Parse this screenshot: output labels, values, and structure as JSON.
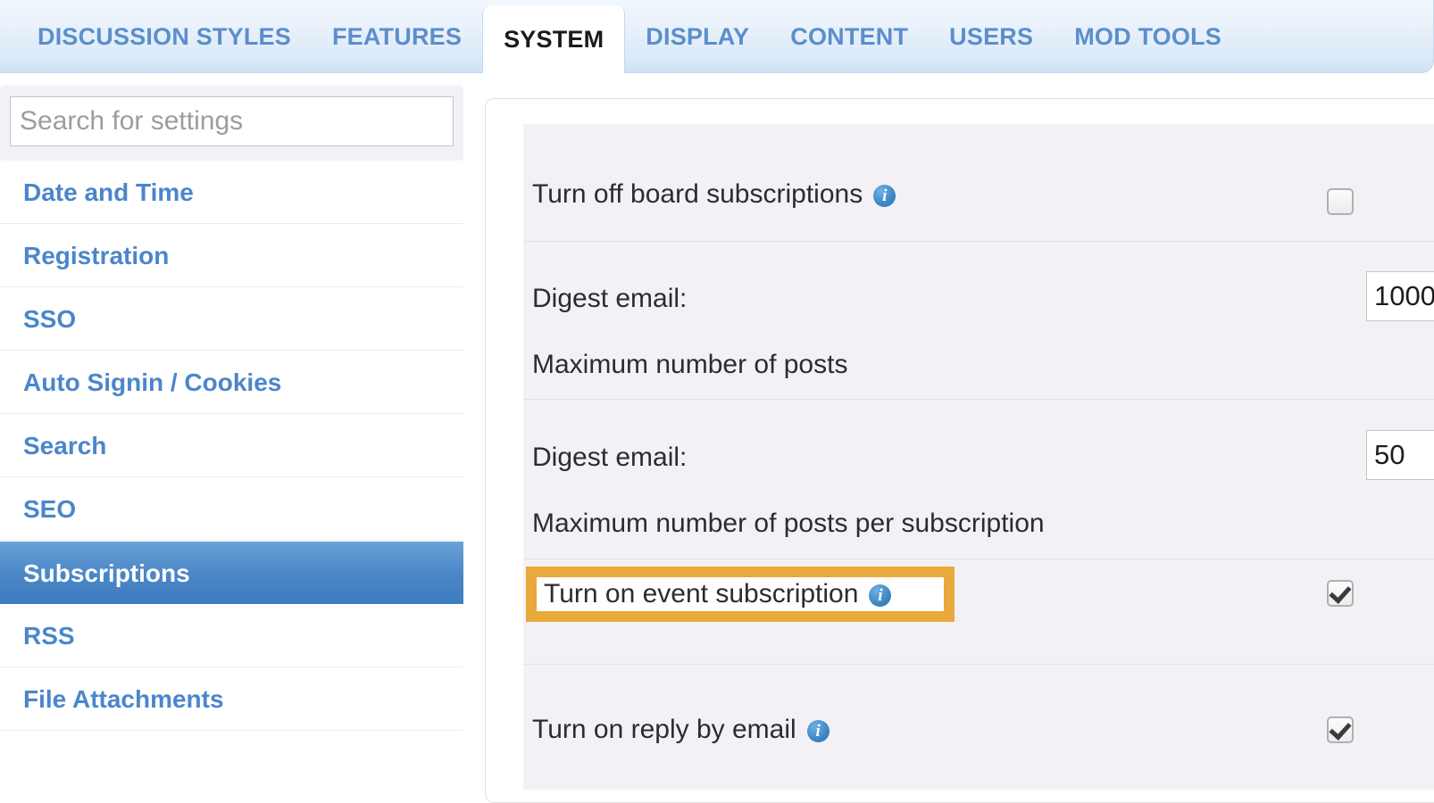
{
  "tabs": [
    {
      "label": "DISCUSSION STYLES",
      "active": false
    },
    {
      "label": "FEATURES",
      "active": false
    },
    {
      "label": "SYSTEM",
      "active": true
    },
    {
      "label": "DISPLAY",
      "active": false
    },
    {
      "label": "CONTENT",
      "active": false
    },
    {
      "label": "USERS",
      "active": false
    },
    {
      "label": "MOD TOOLS",
      "active": false
    }
  ],
  "sidebar": {
    "search": {
      "placeholder": "Search for settings",
      "value": ""
    },
    "items": [
      {
        "label": "Date and Time",
        "active": false
      },
      {
        "label": "Registration",
        "active": false
      },
      {
        "label": "SSO",
        "active": false
      },
      {
        "label": "Auto Signin / Cookies",
        "active": false
      },
      {
        "label": "Search",
        "active": false
      },
      {
        "label": "SEO",
        "active": false
      },
      {
        "label": "Subscriptions",
        "active": true
      },
      {
        "label": "RSS",
        "active": false
      },
      {
        "label": "File Attachments",
        "active": false
      }
    ]
  },
  "settings": {
    "row1": {
      "label": "Turn off board subscriptions",
      "info": "info-icon",
      "checkbox_state": "unchecked"
    },
    "row2": {
      "label": "Digest email:",
      "sublabel": "Maximum number of posts",
      "value": "1000"
    },
    "row3": {
      "label": "Digest email:",
      "sublabel": "Maximum number of posts per subscription",
      "value": "50"
    },
    "row4": {
      "label": "Turn on event subscription",
      "info": "info-icon",
      "checkbox_state": "checked",
      "highlighted": true
    },
    "row5": {
      "label": "Turn on reply by email",
      "info": "info-icon",
      "checkbox_state": "checked"
    }
  },
  "colors": {
    "tab_link": "#5b8ecb",
    "sidebar_link": "#4a86cc",
    "sidebar_active_bg": "#4a86c6",
    "highlight": "#e9a93b",
    "panel_bg": "#f4f1f6",
    "info_icon": "#3d86c6"
  }
}
